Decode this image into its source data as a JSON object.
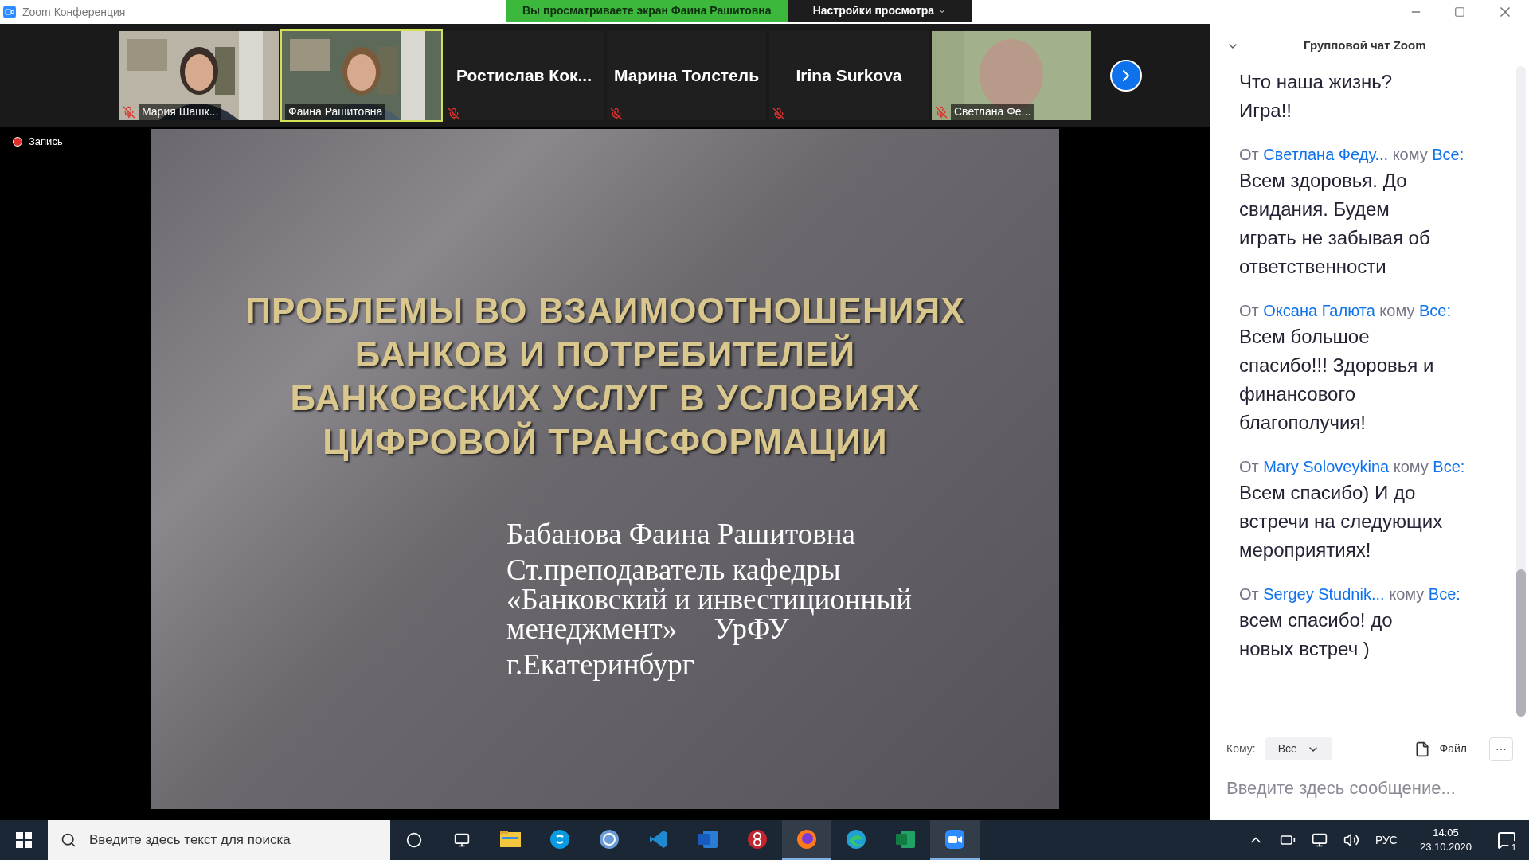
{
  "window": {
    "title": "Zoom Конференция"
  },
  "share_banner": {
    "text": "Вы просматриваете экран Фаина Рашитовна",
    "view_options": "Настройки просмотра"
  },
  "participants": [
    {
      "kind": "video",
      "name": "Мария Шашк...",
      "muted": true,
      "selected": false
    },
    {
      "kind": "video",
      "name": "Фаина Рашитовна",
      "muted": false,
      "selected": true
    },
    {
      "kind": "name",
      "name": "Ростислав  Кок...",
      "muted": true,
      "selected": false
    },
    {
      "kind": "name",
      "name": "Марина Толстель",
      "muted": true,
      "selected": false
    },
    {
      "kind": "name",
      "name": "Irina Surkova",
      "muted": true,
      "selected": false
    },
    {
      "kind": "blur",
      "name": "Светлана Фе...",
      "muted": true,
      "selected": false
    }
  ],
  "recording": {
    "label": "Запись"
  },
  "slide": {
    "title": [
      "ПРОБЛЕМЫ ВО ВЗАИМООТНОШЕНИЯХ",
      "БАНКОВ И ПОТРЕБИТЕЛЕЙ",
      "БАНКОВСКИХ УСЛУГ В УСЛОВИЯХ",
      "ЦИФРОВОЙ ТРАНСФОРМАЦИИ"
    ],
    "author_lines": [
      "Бабанова Фаина Рашитовна",
      "Ст.преподаватель кафедры",
      "«Банковский и инвестиционный",
      "менеджмент»     УрФУ",
      "г.Екатеринбург"
    ]
  },
  "chat": {
    "title": "Групповой чат Zoom",
    "messages": [
      {
        "text": "Что наша жизнь? Игра!!"
      },
      {
        "from_label": "От",
        "sender": "Светлана Феду...",
        "to_label": "кому",
        "recipient": "Все:",
        "text": "Всем здоровья. До свидания. Будем играть не забывая об ответственности"
      },
      {
        "from_label": "От",
        "sender": "Оксана Галюта",
        "to_label": "кому",
        "recipient": "Все:",
        "text": "Всем большое спасибо!!! Здоровья и финансового благополучия!"
      },
      {
        "from_label": "От",
        "sender": "Mary Soloveykina",
        "to_label": "кому",
        "recipient": "Все:",
        "text": "Всем спасибо) И до встречи на следующих мероприятиях!"
      },
      {
        "from_label": "От",
        "sender": "Sergey Studnik...",
        "to_label": "кому",
        "recipient": "Все:",
        "text": "всем спасибо! до новых встреч )"
      }
    ],
    "to_label": "Кому:",
    "to_value": "Все",
    "file_label": "Файл",
    "more": "···",
    "input_placeholder": "Введите здесь сообщение..."
  },
  "taskbar": {
    "search_placeholder": "Введите здесь текст для поиска",
    "language": "РУС",
    "time": "14:05",
    "date": "23.10.2020",
    "notifications": "1",
    "apps": [
      {
        "kind": "explorer",
        "selected": false
      },
      {
        "kind": "skype",
        "selected": false
      },
      {
        "kind": "qbit",
        "selected": false
      },
      {
        "kind": "vscode",
        "selected": false
      },
      {
        "kind": "word",
        "selected": false
      },
      {
        "kind": "red",
        "selected": false
      },
      {
        "kind": "firefox",
        "selected": true
      },
      {
        "kind": "edge",
        "selected": false
      },
      {
        "kind": "excel",
        "selected": false
      },
      {
        "kind": "zoom",
        "selected": true
      }
    ]
  }
}
